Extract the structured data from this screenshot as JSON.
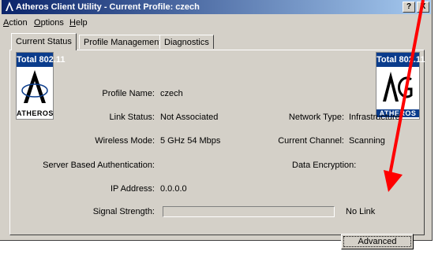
{
  "window": {
    "title": "Atheros Client Utility - Current Profile: czech",
    "help_btn": "?",
    "close_btn": "X"
  },
  "menu": [
    {
      "label": "Action",
      "underline": "A"
    },
    {
      "label": "Options",
      "underline": "O"
    },
    {
      "label": "Help",
      "underline": "H"
    }
  ],
  "tabs": [
    {
      "label": "Current Status",
      "active": true
    },
    {
      "label": "Profile Management",
      "active": false
    },
    {
      "label": "Diagnostics",
      "active": false
    }
  ],
  "logos": {
    "left": {
      "band": "Total 802.11",
      "letter": "A",
      "brand": "ATHEROS"
    },
    "right": {
      "band": "Total 802.11",
      "letter": "AG",
      "brand": "ATHEROS"
    }
  },
  "status": {
    "profile_name_label": "Profile Name:",
    "profile_name": "czech",
    "link_status_label": "Link Status:",
    "link_status": "Not Associated",
    "wireless_mode_label": "Wireless Mode:",
    "wireless_mode": "5 GHz 54 Mbps",
    "server_auth_label": "Server Based Authentication:",
    "ip_address_label": "IP Address:",
    "ip_address": "0.0.0.0",
    "network_type_label": "Network Type:",
    "network_type": "Infrastructure",
    "current_channel_label": "Current Channel:",
    "current_channel": "Scanning",
    "data_encryption_label": "Data Encryption:",
    "signal_strength_label": "Signal Strength:",
    "signal_text": "No Link",
    "signal_level": 0
  },
  "buttons": {
    "advanced": "Advanced"
  },
  "annotation": {
    "arrow_color": "#ff0000"
  }
}
